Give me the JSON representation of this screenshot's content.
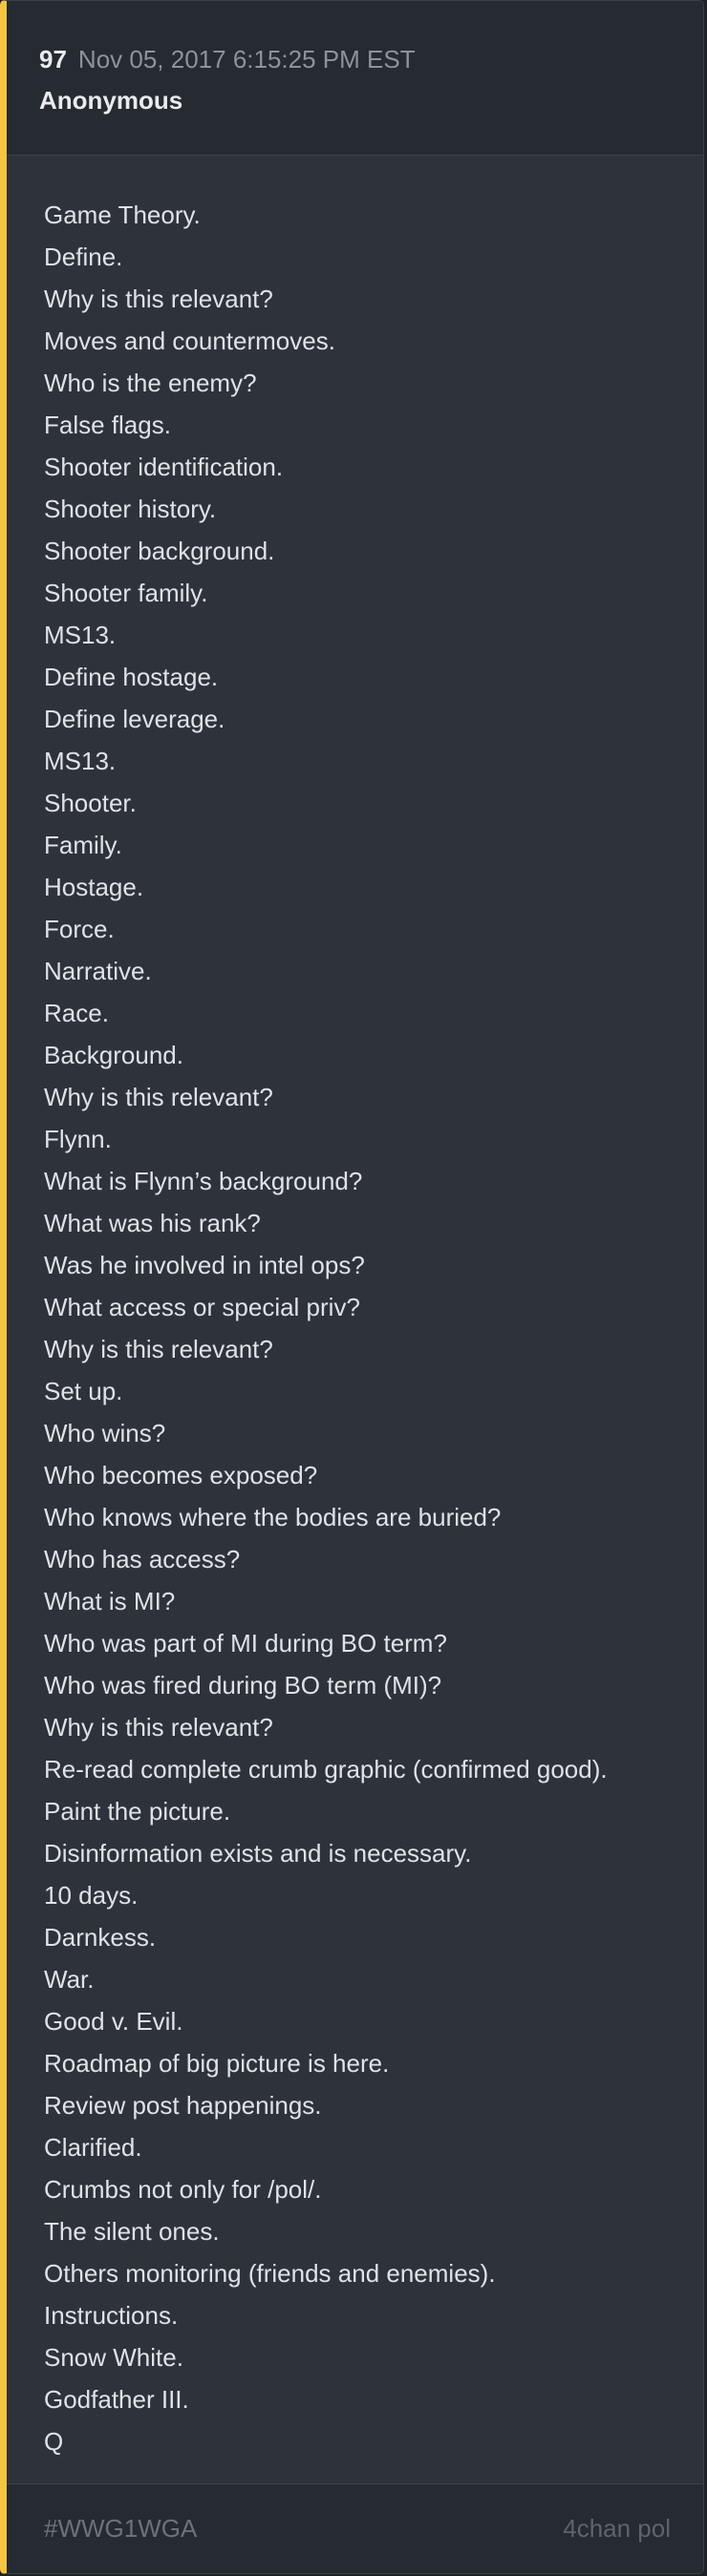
{
  "post": {
    "number": "97",
    "timestamp": "Nov 05, 2017 6:15:25 PM EST",
    "author": "Anonymous"
  },
  "lines": [
    "Game Theory.",
    "Define.",
    "Why is this relevant?",
    "Moves and countermoves.",
    "Who is the enemy?",
    "False flags.",
    "Shooter identification.",
    "Shooter history.",
    "Shooter background.",
    "Shooter family.",
    "MS13.",
    "Define hostage.",
    "Define leverage.",
    "MS13.",
    "Shooter.",
    "Family.",
    "Hostage.",
    "Force.",
    "Narrative.",
    "Race.",
    "Background.",
    "Why is this relevant?",
    "Flynn.",
    "What is Flynn’s background?",
    "What was his rank?",
    "Was he involved in intel ops?",
    "What access or special priv?",
    "Why is this relevant?",
    "Set up.",
    "Who wins?",
    "Who becomes exposed?",
    "Who knows where the bodies are buried?",
    "Who has access?",
    "What is MI?",
    "Who was part of MI during BO term?",
    "Who was fired during BO term (MI)?",
    "Why is this relevant?",
    "Re-read complete crumb graphic (confirmed good).",
    "Paint the picture.",
    "Disinformation exists and is necessary.",
    "10 days.",
    "Darnkess.",
    "War.",
    "Good v. Evil.",
    "Roadmap of big picture is here.",
    "Review post happenings.",
    "Clarified.",
    "Crumbs not only for /pol/.",
    "The silent ones.",
    "Others monitoring (friends and enemies).",
    "Instructions.",
    "Snow White.",
    "Godfather III.",
    "Q"
  ],
  "footer": {
    "tag": "#WWG1WGA",
    "source": "4chan pol"
  },
  "colors": {
    "accent": "#f4c542",
    "card": "#2e323a",
    "header": "#262a31",
    "text": "#dfe2e6",
    "muted": "#8d939c"
  }
}
